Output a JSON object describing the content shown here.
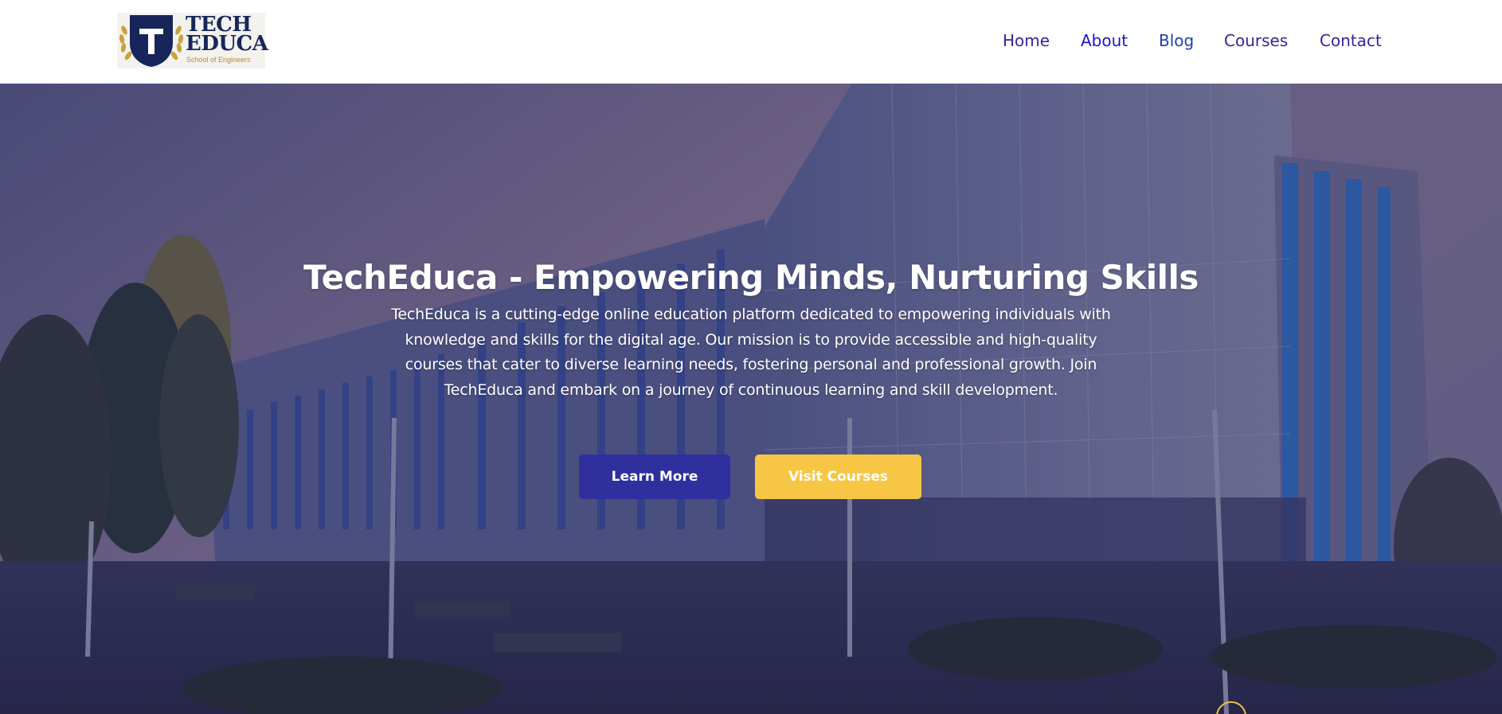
{
  "brand": {
    "logo_line1": "TECH",
    "logo_line2": "EDUCA",
    "logo_tagline": "School of Engineers",
    "logo_letter": "T",
    "navy": "#16265a",
    "gold": "#c9a23a"
  },
  "nav": {
    "items": [
      {
        "label": "Home",
        "color": "#3b1f9e"
      },
      {
        "label": "About",
        "color": "#1a13c9"
      },
      {
        "label": "Blog",
        "color": "#1d3db8"
      },
      {
        "label": "Courses",
        "color": "#3b1f9e"
      },
      {
        "label": "Contact",
        "color": "#3b1f9e"
      }
    ]
  },
  "hero": {
    "title": "TechEduca - Empowering Minds, Nurturing Skills",
    "description": "TechEduca is a cutting-edge online education platform dedicated to empowering individuals with knowledge and skills for the digital age. Our mission is to provide accessible and high-quality courses that cater to diverse learning needs, fostering personal and professional growth. Join TechEduca and embark on a journey of continuous learning and skill development.",
    "background_image": "campus-building-photo",
    "buttons": {
      "learn_more": "Learn More",
      "visit_courses": "Visit Courses"
    },
    "colors": {
      "primary_button": "#2f2f9e",
      "secondary_button": "#f7c644"
    }
  }
}
